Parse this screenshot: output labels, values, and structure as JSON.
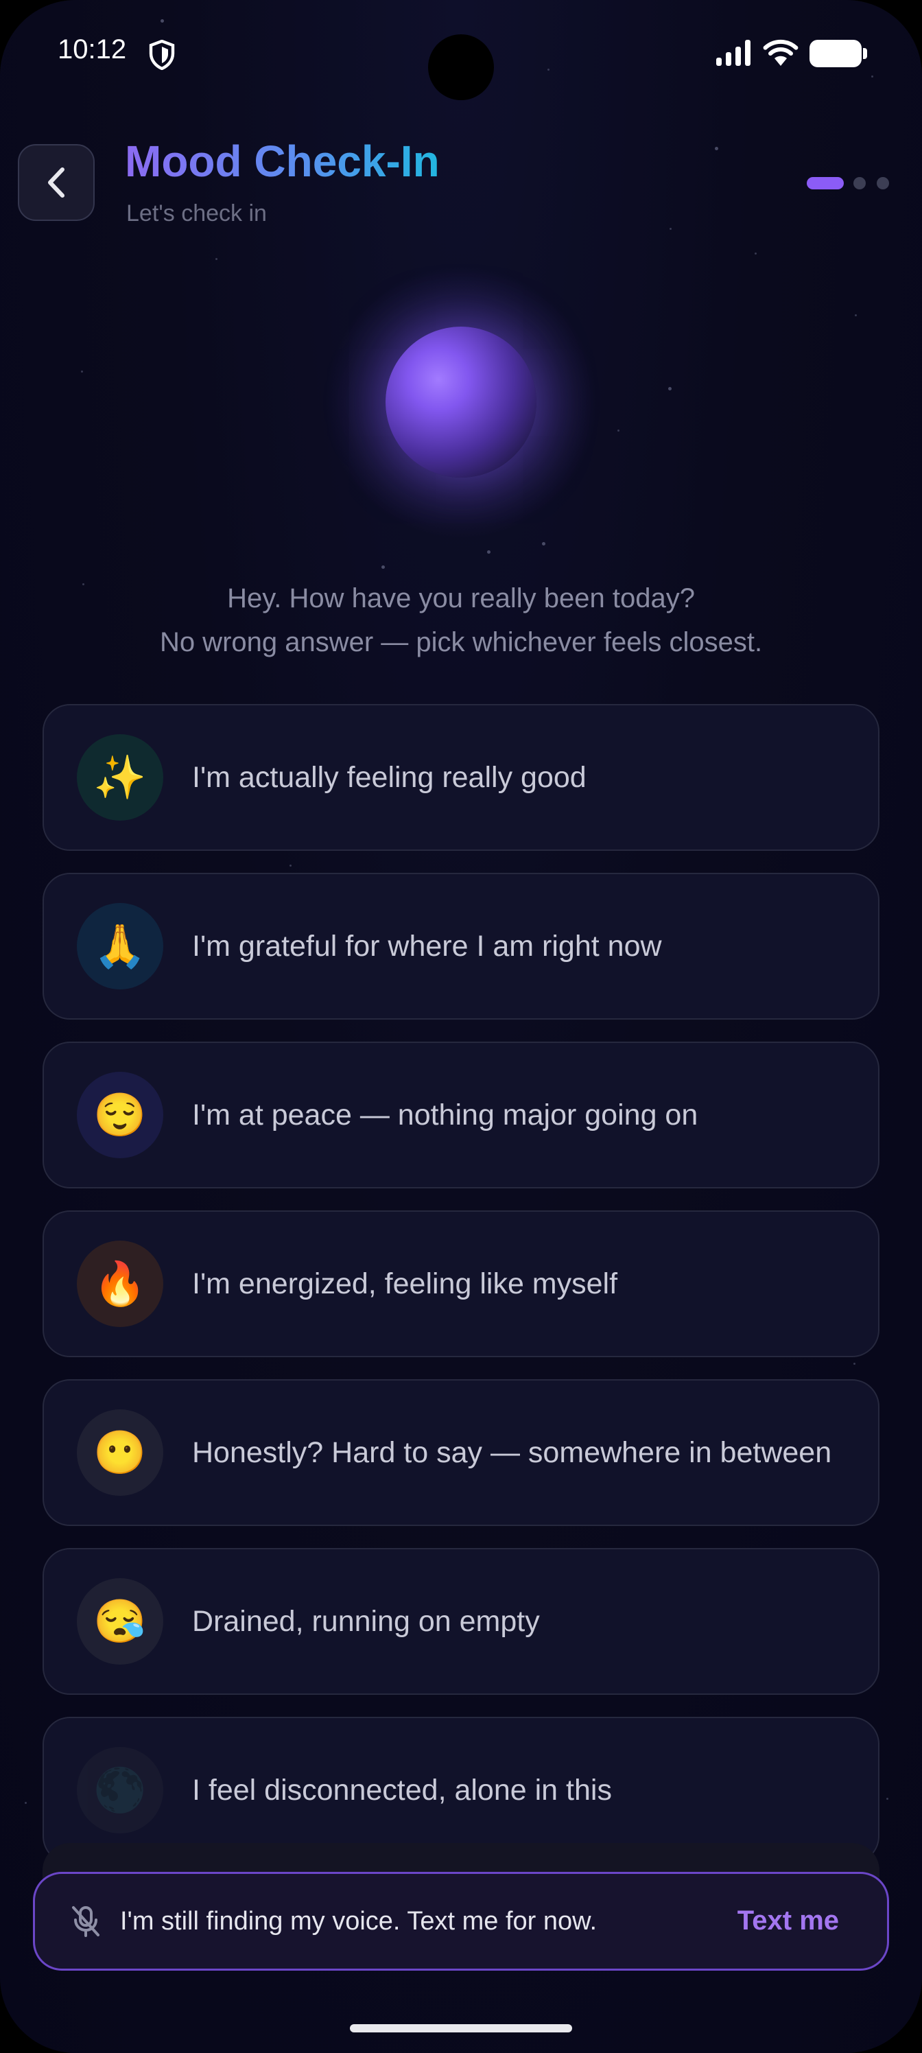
{
  "status_bar": {
    "time": "10:12"
  },
  "header": {
    "title": "Mood Check-In",
    "subtitle": "Let's check in",
    "step_indicator": {
      "current": 1,
      "total": 3
    }
  },
  "prompt": {
    "line1": "Hey. How have you really been today?",
    "line2": "No wrong answer — pick whichever feels closest."
  },
  "options": [
    {
      "emoji": "✨",
      "label": "I'm actually feeling really good",
      "icon_bg": "#0f2a2f"
    },
    {
      "emoji": "🙏",
      "label": "I'm grateful for where I am right now",
      "icon_bg": "#0f2540"
    },
    {
      "emoji": "😌",
      "label": "I'm at peace — nothing major going on",
      "icon_bg": "#1a1b45"
    },
    {
      "emoji": "🔥",
      "label": "I'm energized, feeling like myself",
      "icon_bg": "#2e1f22"
    },
    {
      "emoji": "😶",
      "label": "Honestly? Hard to say — somewhere in between",
      "icon_bg": "#1f2033"
    },
    {
      "emoji": "😪",
      "label": "Drained, running on empty",
      "icon_bg": "#1f2033"
    },
    {
      "emoji": "🌑",
      "label": "I feel disconnected, alone in this",
      "icon_bg": "#1f2033"
    }
  ],
  "voice_bar": {
    "icon": "mic-off-icon",
    "text": "I'm still finding my voice. Text me for now.",
    "action_label": "Text me"
  },
  "colors": {
    "accent": "#8b5cf6",
    "action": "#a376f0",
    "background": "#0a0a1d"
  }
}
